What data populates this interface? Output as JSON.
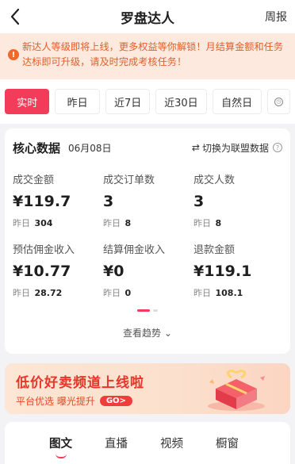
{
  "header": {
    "title": "罗盘达人",
    "weekly": "周报"
  },
  "notice": {
    "text": "新达人等级即将上线，更多权益等你解锁！月结算金额和任务达标即可升级，请及时完成考核任务！"
  },
  "tabs": [
    {
      "label": "实时",
      "active": true
    },
    {
      "label": "昨日",
      "active": false
    },
    {
      "label": "近7日",
      "active": false
    },
    {
      "label": "近30日",
      "active": false
    },
    {
      "label": "自然日",
      "active": false
    }
  ],
  "core": {
    "title": "核心数据",
    "date": "06月08日",
    "switch_label": "切换为联盟数据",
    "yest_prefix": "昨日",
    "metrics": [
      {
        "label": "成交金额",
        "value": "¥119.7",
        "yesterday": "304"
      },
      {
        "label": "成交订单数",
        "value": "3",
        "yesterday": "8"
      },
      {
        "label": "成交人数",
        "value": "3",
        "yesterday": "8"
      },
      {
        "label": "预估佣金收入",
        "value": "¥10.77",
        "yesterday": "28.72"
      },
      {
        "label": "结算佣金收入",
        "value": "¥0",
        "yesterday": "0"
      },
      {
        "label": "退款金额",
        "value": "¥119.1",
        "yesterday": "108.1"
      }
    ],
    "trend_label": "查看趋势"
  },
  "banner": {
    "title": "低价好卖频道上线啦",
    "subtitle": "平台优选 曝光提升",
    "go": "GO>"
  },
  "bottom_tabs": [
    {
      "label": "图文",
      "active": true
    },
    {
      "label": "直播",
      "active": false
    },
    {
      "label": "视频",
      "active": false
    },
    {
      "label": "橱窗",
      "active": false
    }
  ],
  "colors": {
    "accent": "#f23c59",
    "notice_text": "#e0602d",
    "notice_bg": "#fde9dd"
  }
}
